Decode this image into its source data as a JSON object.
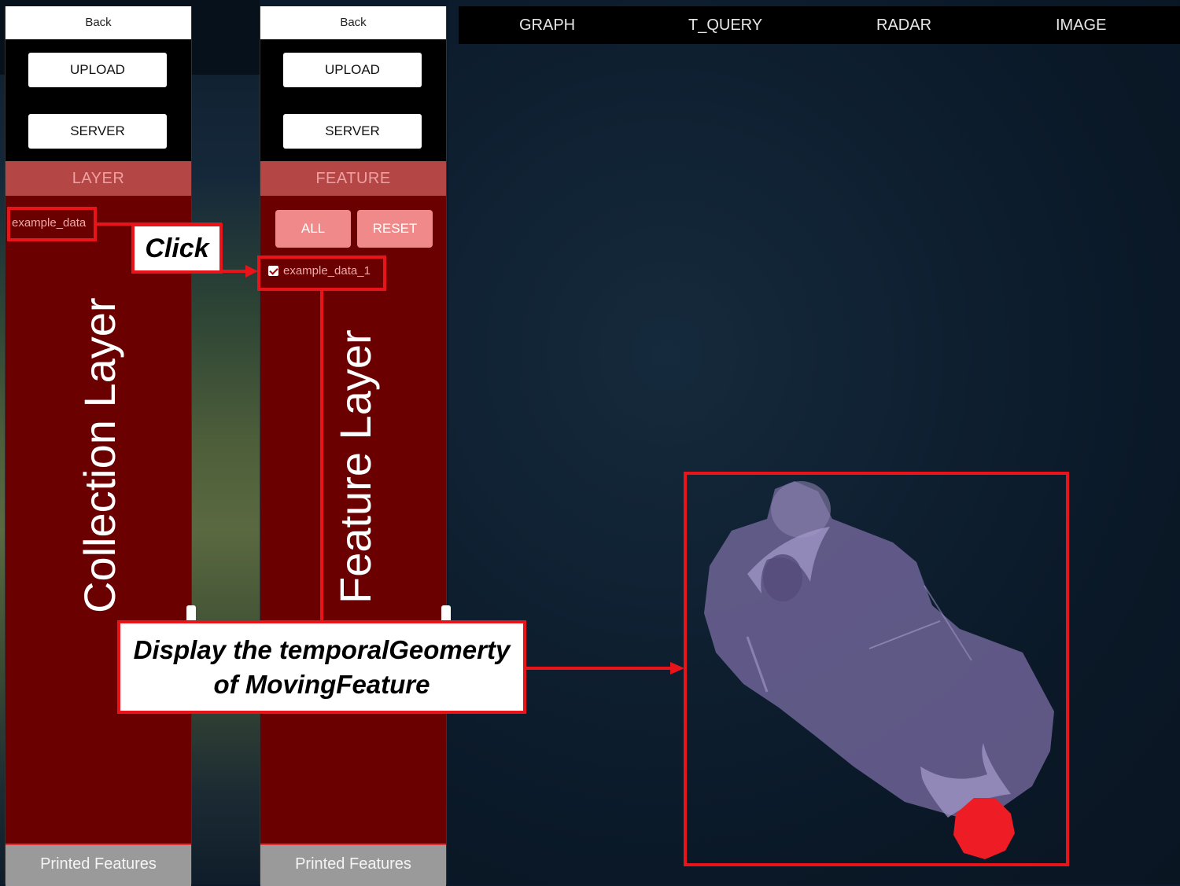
{
  "collection_panel": {
    "back_label": "Back",
    "upload_label": "UPLOAD",
    "server_label": "SERVER",
    "section_label": "LAYER",
    "items": [
      "example_data"
    ],
    "footer_label": "Printed Features"
  },
  "feature_panel": {
    "back_label": "Back",
    "upload_label": "UPLOAD",
    "server_label": "SERVER",
    "section_label": "FEATURE",
    "all_label": "ALL",
    "reset_label": "RESET",
    "items": [
      {
        "label": "example_data_1",
        "checked": true
      }
    ],
    "footer_label": "Printed Features"
  },
  "tabs": [
    "GRAPH",
    "T_QUERY",
    "RADAR",
    "IMAGE"
  ],
  "annotations": {
    "click_label": "Click",
    "collection_layer_label": "Collection Layer",
    "feature_layer_label": "Feature Layer",
    "display_line1": "Display the temporalGeomerty",
    "display_line2": "of MovingFeature"
  },
  "colors": {
    "annotation_red": "#e8141a",
    "panel_red": "#6a0000",
    "section_header": "#b44646",
    "geometry_fill": "#6e6496",
    "moving_point": "#ee1c24"
  }
}
